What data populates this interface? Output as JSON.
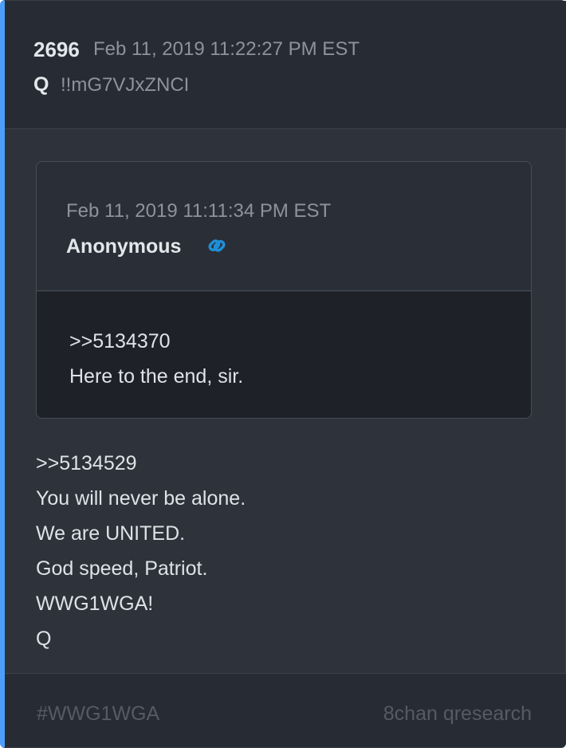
{
  "post": {
    "number": "2696",
    "timestamp": "Feb 11, 2019 11:22:27 PM EST",
    "author": "Q",
    "tripcode": "!!mG7VJxZNCI"
  },
  "quoted_post": {
    "timestamp": "Feb 11, 2019 11:11:34 PM EST",
    "author": "Anonymous",
    "link_icon": "link-icon",
    "lines": [
      ">>5134370",
      "Here to the end, sir."
    ]
  },
  "message": {
    "lines": [
      ">>5134529",
      "You will never be alone.",
      "We are UNITED.",
      "God speed, Patriot.",
      "WWG1WGA!",
      "Q"
    ]
  },
  "footer": {
    "hashtag": "#WWG1WGA",
    "source": "8chan qresearch"
  },
  "colors": {
    "accent": "#4d9ef8",
    "link_icon": "#1f8fd8",
    "card_background": "#2d323b",
    "quote_body_background": "#1e2128"
  }
}
